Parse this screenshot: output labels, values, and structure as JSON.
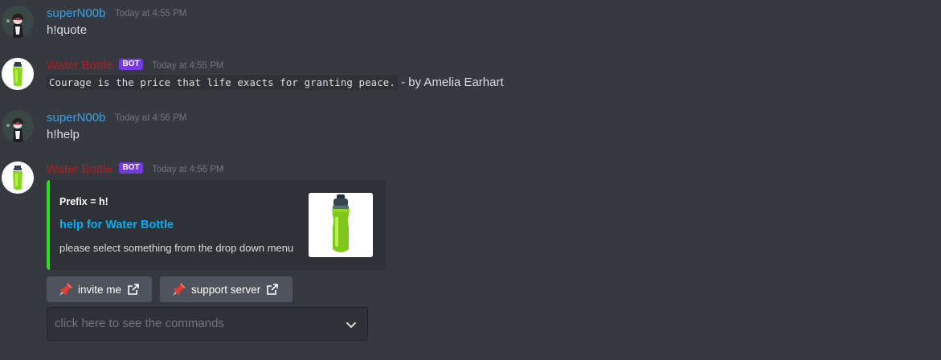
{
  "messages": [
    {
      "author": "superN00b",
      "timestamp": "Today at 4:55 PM",
      "text": "h!quote"
    },
    {
      "author": "Water Bottle",
      "bot_tag": "BOT",
      "timestamp": "Today at 4:55 PM",
      "code": "Courage is the price that life exacts for granting peace.",
      "suffix": " - by Amelia Earhart"
    },
    {
      "author": "superN00b",
      "timestamp": "Today at 4:56 PM",
      "text": "h!help"
    },
    {
      "author": "Water Bottle",
      "bot_tag": "BOT",
      "timestamp": "Today at 4:56 PM",
      "embed": {
        "author": "Prefix = h!",
        "title": "help for Water Bottle",
        "description": "please select something from the drop down menu",
        "accent_color": "#27e319",
        "thumbnail_icon": "water-bottle-icon"
      },
      "buttons": [
        {
          "label": "invite me",
          "emoji": "pushpin-icon",
          "link_icon": "external-link-icon"
        },
        {
          "label": "support server",
          "emoji": "pushpin-icon",
          "link_icon": "external-link-icon"
        }
      ],
      "select": {
        "placeholder": "click here to see the commands",
        "icon": "chevron-down-icon"
      }
    }
  ],
  "colors": {
    "background": "#36393f",
    "user_name": "#3ba2e6",
    "bot_name": "#b71c1c",
    "bot_tag": "#7637e6",
    "link": "#00aff4"
  }
}
